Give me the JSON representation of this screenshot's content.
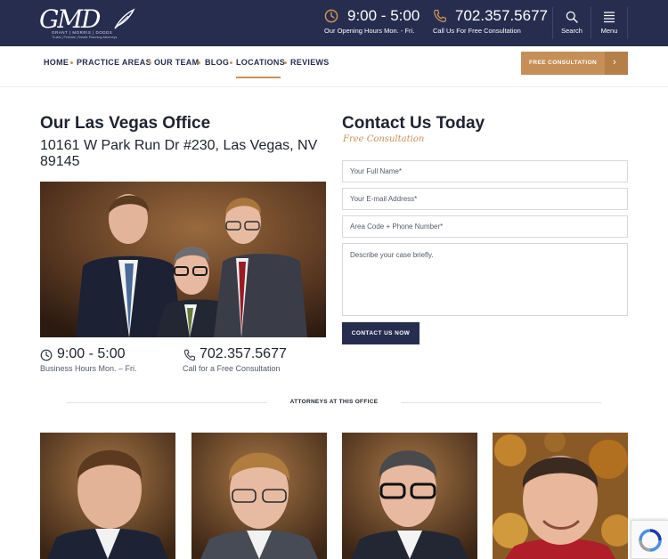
{
  "header": {
    "logo": {
      "monogram": "GMD",
      "names": "GRANT | MORRIS | DODDS",
      "tagline": "Trusts | Probate | Estate Planning Attorneys"
    },
    "hours": {
      "value": "9:00 - 5:00",
      "caption": "Our Opening Hours Mon. - Fri."
    },
    "phone": {
      "value": "702.357.5677",
      "caption": "Call Us For Free Consultation"
    },
    "search_label": "Search",
    "menu_label": "Menu",
    "colors": {
      "bar": "#262d4f",
      "accent": "#c99158"
    }
  },
  "nav": {
    "items": [
      "HOME",
      "PRACTICE AREAS",
      "OUR TEAM",
      "BLOG",
      "LOCATIONS",
      "REVIEWS"
    ],
    "active": "LOCATIONS",
    "cta_label": "FREE CONSULTATION"
  },
  "office": {
    "title": "Our Las Vegas Office",
    "address": "10161 W Park Run Dr #230, Las Vegas, NV 89145",
    "hours_value": "9:00 - 5:00",
    "hours_caption": "Business Hours Mon. – Fri.",
    "phone_value": "702.357.5677",
    "phone_caption": "Call for a Free Consultation"
  },
  "contact": {
    "title": "Contact Us Today",
    "subtitle": "Free Consultation",
    "name_placeholder": "Your Full Name*",
    "email_placeholder": "Your E-mail Address*",
    "phone_placeholder": "Area Code + Phone Number*",
    "message_placeholder": "Describe your case briefly.",
    "submit_label": "CONTACT US NOW"
  },
  "attorneys": {
    "heading": "ATTORNEYS AT THIS OFFICE",
    "cards": [
      {
        "photo": "attorney-1-portrait"
      },
      {
        "photo": "attorney-2-portrait"
      },
      {
        "photo": "attorney-3-portrait"
      },
      {
        "photo": "attorney-4-portrait"
      }
    ]
  }
}
